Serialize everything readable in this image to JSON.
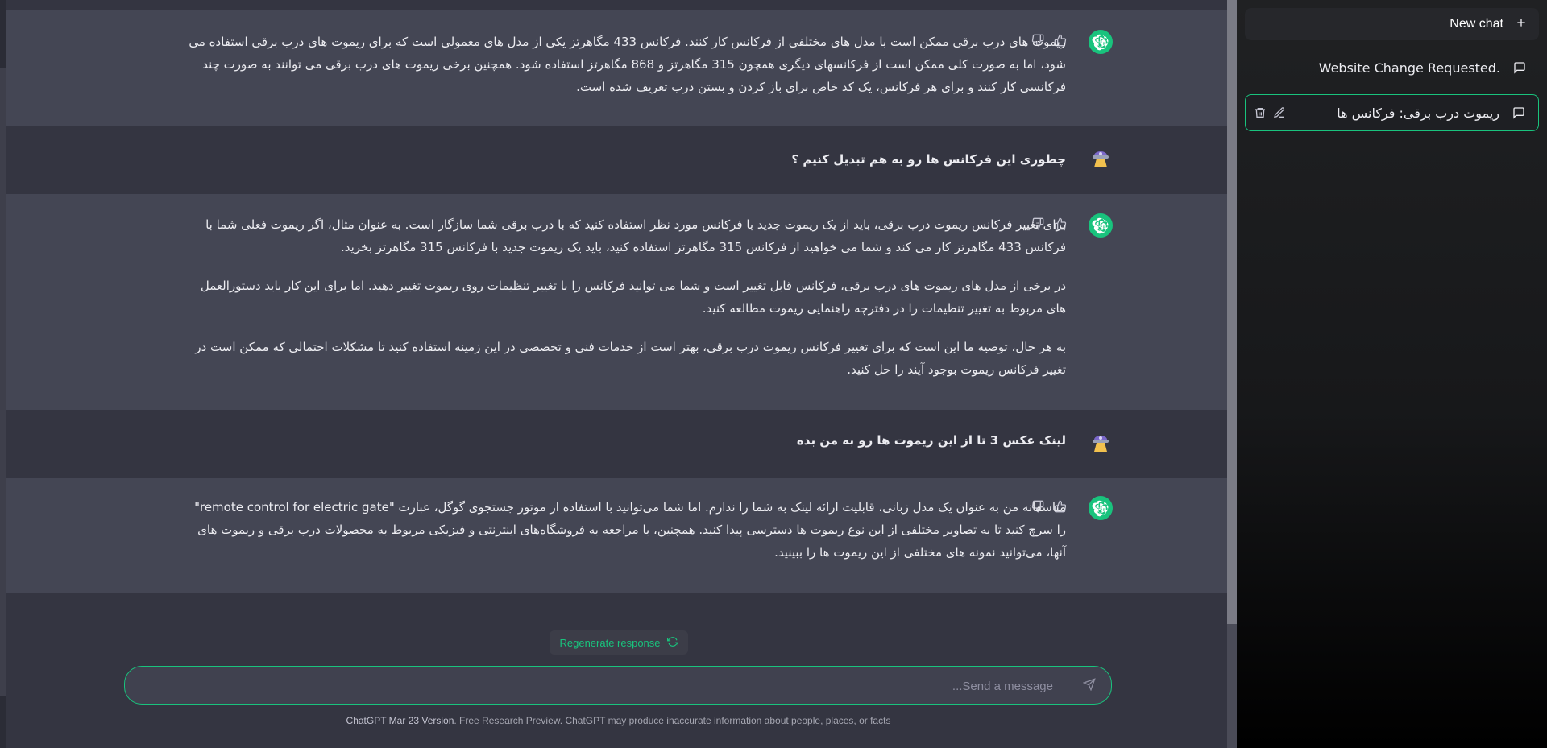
{
  "sidebar": {
    "new_chat_label": "New chat",
    "conversations": [
      {
        "title": "Website Change Requested.",
        "active": false
      },
      {
        "title": "ریموت درب برقی: فرکانس ها",
        "active": true
      }
    ]
  },
  "messages": [
    {
      "role": "assistant",
      "paragraphs": [
        "ریموت های درب برقی ممکن است با مدل های مختلفی از فرکانس کار کنند. فرکانس 433 مگاهرتز یکی از مدل های معمولی است که برای ریموت های درب برقی استفاده می شود، اما به صورت کلی ممکن است از فرکانسهای دیگری همچون 315 مگاهرتز و 868 مگاهرتز استفاده شود. همچنین برخی ریموت های درب برقی می توانند به صورت چند فرکانسی کار کنند و برای هر فرکانس، یک کد خاص برای باز کردن و بستن درب تعریف شده است."
      ]
    },
    {
      "role": "user",
      "paragraphs": [
        "چطوری این فرکانس ها رو به هم تبدیل کنیم ؟"
      ]
    },
    {
      "role": "assistant",
      "paragraphs": [
        "برای تغییر فرکانس ریموت درب برقی، باید از یک ریموت جدید با فرکانس مورد نظر استفاده کنید که با درب برقی شما سازگار است. به عنوان مثال، اگر ریموت فعلی شما با فرکانس 433 مگاهرتز کار می کند و شما می خواهید از فرکانس 315 مگاهرتز استفاده کنید، باید یک ریموت جدید با فرکانس 315 مگاهرتز بخرید.",
        "در برخی از مدل های ریموت های درب برقی، فرکانس قابل تغییر است و شما می توانید فرکانس را با تغییر تنظیمات روی ریموت تغییر دهید. اما برای این کار باید دستورالعمل های مربوط به تغییر تنظیمات را در دفترچه راهنمایی ریموت مطالعه کنید.",
        "به هر حال، توصیه ما این است که برای تغییر فرکانس ریموت درب برقی، بهتر است از خدمات فنی و تخصصی در این زمینه استفاده کنید تا مشکلات احتمالی که ممکن است در تغییر فرکانس ریموت بوجود آیند را حل کنید."
      ]
    },
    {
      "role": "user",
      "paragraphs": [
        "لینک عکس 3 تا از این ریموت ها رو به من بده"
      ]
    },
    {
      "role": "assistant",
      "paragraphs": [
        "متاسفانه من به عنوان یک مدل زبانی، قابلیت ارائه لینک به شما را ندارم. اما شما می‌توانید با استفاده از موتور جستجوی گوگل، عبارت \"remote control for electric gate\" را سرچ کنید تا به تصاویر مختلفی از این نوع ریموت ها دسترسی پیدا کنید. همچنین، با مراجعه به فروشگاه‌های اینترنتی و فیزیکی مربوط به محصولات درب برقی و ریموت های آنها، می‌توانید نمونه های مختلفی از این ریموت ها را ببینید."
      ]
    }
  ],
  "composer": {
    "regenerate_label": "Regenerate response",
    "placeholder": "Send a message...",
    "value": ""
  },
  "footer": {
    "version_link": "ChatGPT Mar 23 Version",
    "disclaimer": ". Free Research Preview. ChatGPT may produce inaccurate information about people, places, or facts"
  },
  "colors": {
    "accent": "#19c37d",
    "main_bg": "#343541",
    "assistant_bg": "#444654",
    "sidebar_bg": "#202123"
  }
}
